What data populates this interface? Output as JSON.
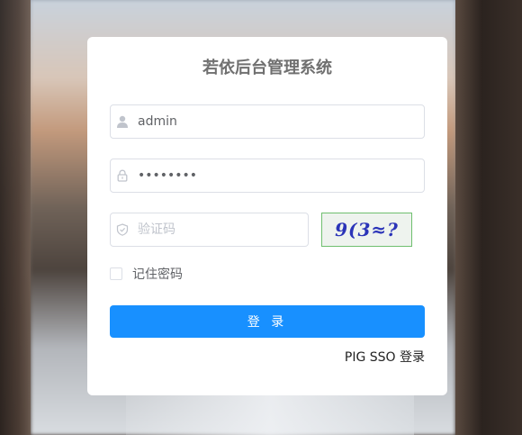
{
  "login": {
    "title": "若依后台管理系统",
    "username_value": "admin",
    "password_value": "••••••••",
    "code_placeholder": "验证码",
    "captcha_text": "9(3≈?",
    "remember_label": "记住密码",
    "remember_checked": false,
    "submit_label": "登 录",
    "sso_link": "PIG SSO 登录"
  },
  "colors": {
    "primary": "#1890ff",
    "title": "#707070",
    "captcha_text": "#2b34b8",
    "captcha_border": "#6fbf6f"
  },
  "icons": {
    "username": "user-icon",
    "password": "lock-icon",
    "code": "shield-icon"
  }
}
